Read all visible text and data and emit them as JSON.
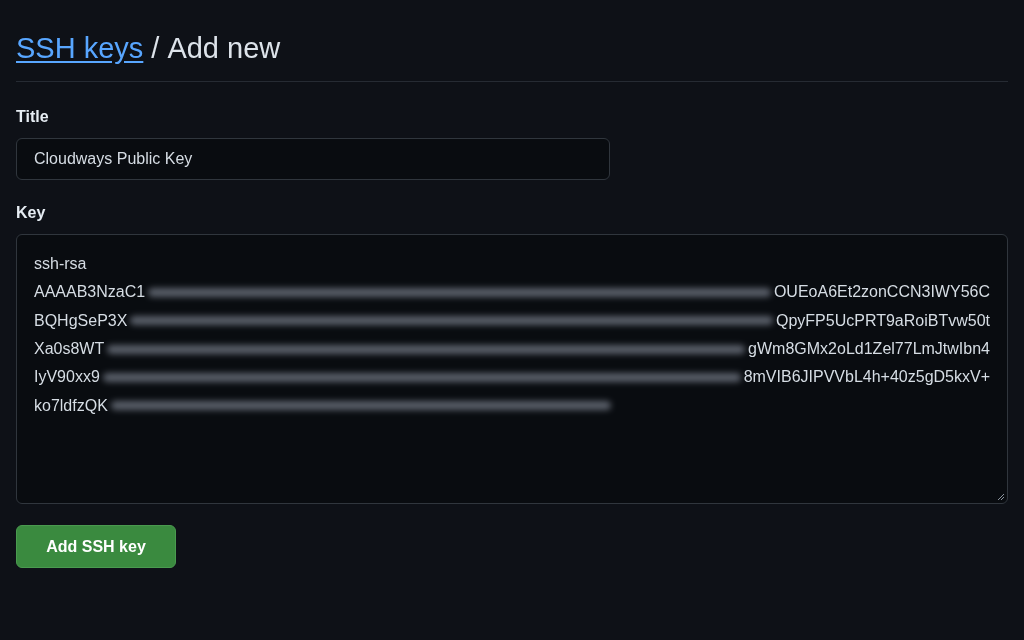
{
  "heading": {
    "link": "SSH keys",
    "separator": "/",
    "title": "Add new"
  },
  "title_field": {
    "label": "Title",
    "value": "Cloudways Public Key"
  },
  "key_field": {
    "label": "Key",
    "lines": [
      {
        "start": "ssh-rsa",
        "redacted": false
      },
      {
        "start": "AAAAB3NzaC1",
        "redacted": true,
        "end": "OUEoA6Et2zonCCN3IWY56C"
      },
      {
        "start": "BQHgSeP3X",
        "redacted": true,
        "end": "QpyFP5UcPRT9aRoiBTvw50t"
      },
      {
        "start": "Xa0s8WT",
        "redacted": true,
        "end": "gWm8GMx2oLd1Zel77LmJtwIbn4"
      },
      {
        "start": "IyV90xx9",
        "redacted": true,
        "end": "8mVIB6JIPVVbL4h+40z5gD5kxV+"
      },
      {
        "start": "ko7ldfzQK",
        "redacted": true
      }
    ]
  },
  "button": "Add SSH key"
}
